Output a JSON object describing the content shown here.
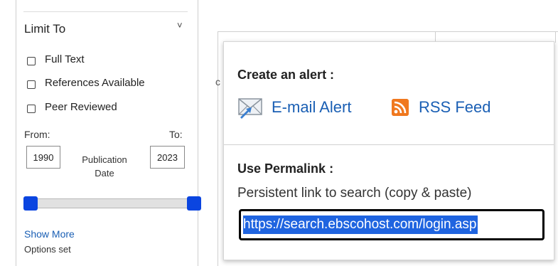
{
  "limit_panel": {
    "title": "Limit To",
    "collapse_glyph": "˅",
    "checkboxes": [
      {
        "label": "Full Text",
        "checked": false
      },
      {
        "label": "References Available",
        "checked": false
      },
      {
        "label": "Peer Reviewed",
        "checked": false
      }
    ],
    "from_label": "From:",
    "to_label": "To:",
    "from_year": "1990",
    "to_year": "2023",
    "publication_date_label": "Publication Date",
    "show_more": "Show More",
    "options_set": "Options set",
    "slider_color": "#0b45e0"
  },
  "background": {
    "peek_text": "c"
  },
  "popup": {
    "alert_heading": "Create an alert :",
    "email_alert": "E-mail Alert",
    "email_icon": "envelope-icon",
    "rss_feed": "RSS Feed",
    "rss_icon": "rss-icon",
    "permalink_heading": "Use Permalink :",
    "persistent_text": "Persistent link to search (copy & paste)",
    "permalink_value": "https://search.ebscohost.com/login.asp",
    "link_color": "#1a5fb4",
    "rss_color": "#f0781e",
    "selection_color": "#1f64e0"
  }
}
